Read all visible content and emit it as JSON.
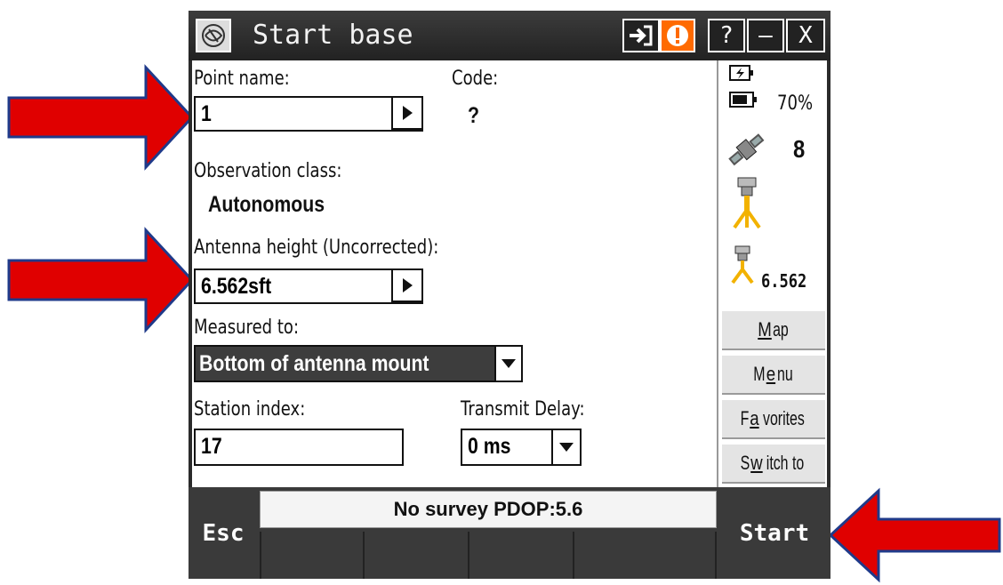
{
  "window": {
    "title": "Start base",
    "buttons": [
      "?",
      "–",
      "X"
    ]
  },
  "form": {
    "point_name_label": "Point name:",
    "point_name_value": "1",
    "code_label": "Code:",
    "code_value": "?",
    "observation_class_label": "Observation class:",
    "observation_class_value": "Autonomous",
    "antenna_height_label": "Antenna height (Uncorrected):",
    "antenna_height_value": "6.562sft",
    "measured_to_label": "Measured to:",
    "measured_to_value": "Bottom of antenna mount",
    "station_index_label": "Station index:",
    "station_index_value": "17",
    "transmit_delay_label": "Transmit Delay:",
    "transmit_delay_value": "0 ms"
  },
  "status_panel": {
    "battery_percent": "70%",
    "satellites": "8",
    "antenna_height": "6.562",
    "buttons": [
      {
        "pre": "",
        "key": "M",
        "post": "ap"
      },
      {
        "pre": "M",
        "key": "e",
        "post": "nu"
      },
      {
        "pre": "F",
        "key": "a",
        "post": "vorites"
      },
      {
        "pre": "S",
        "key": "w",
        "post": "itch to"
      }
    ]
  },
  "bottom": {
    "esc_label": "Esc",
    "status_text": "No survey  PDOP:5.6",
    "start_label": "Start"
  },
  "colors": {
    "annotation_arrow": "#e00000",
    "arrow_outline": "#1f3a8a",
    "alert_orange": "#ff6a00"
  }
}
